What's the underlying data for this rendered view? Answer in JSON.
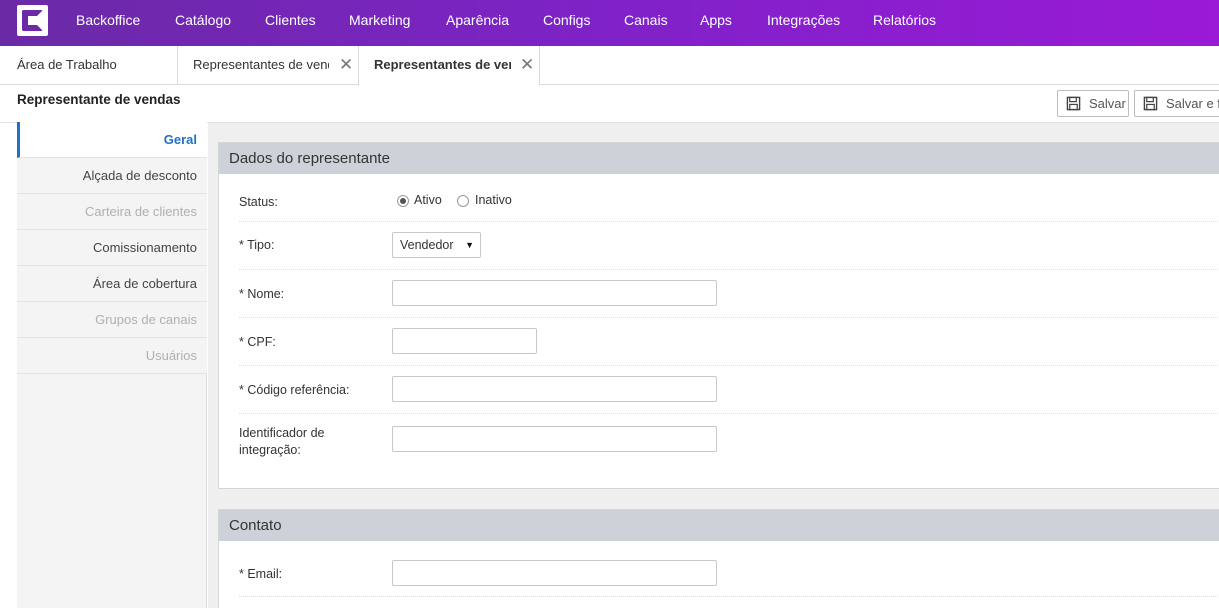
{
  "nav": {
    "items": [
      "Backoffice",
      "Catálogo",
      "Clientes",
      "Marketing",
      "Aparência",
      "Configs",
      "Canais",
      "Apps",
      "Integrações",
      "Relatórios"
    ]
  },
  "tabs": [
    {
      "label": "Área de Trabalho"
    },
    {
      "label": "Representantes de vendas"
    },
    {
      "label": "Representantes de vendas"
    }
  ],
  "header": {
    "title": "Representante de vendas",
    "save_label": "Salvar",
    "save_close_label": "Salvar e fechar"
  },
  "sidebar": {
    "items": [
      {
        "label": "Geral",
        "state": "active"
      },
      {
        "label": "Alçada de desconto",
        "state": "normal"
      },
      {
        "label": "Carteira de clientes",
        "state": "disabled"
      },
      {
        "label": "Comissionamento",
        "state": "normal"
      },
      {
        "label": "Área de cobertura",
        "state": "normal"
      },
      {
        "label": "Grupos de canais",
        "state": "disabled"
      },
      {
        "label": "Usuários",
        "state": "disabled"
      }
    ]
  },
  "section_rep": {
    "title": "Dados do representante",
    "status_label": "Status:",
    "status_options": [
      "Ativo",
      "Inativo"
    ],
    "status_selected": "Ativo",
    "tipo_label": "* Tipo:",
    "tipo_value": "Vendedor",
    "nome_label": "* Nome:",
    "cpf_label": "* CPF:",
    "codigo_label": "* Código referência:",
    "ident_label_1": "Identificador de",
    "ident_label_2": "integração:"
  },
  "section_contato": {
    "title": "Contato",
    "email_label": "* Email:"
  },
  "colors": {
    "nav_start": "#6a2aa6",
    "nav_end": "#9a1ad6",
    "accent": "#1e73c8",
    "section_header": "#ccd2d7"
  }
}
